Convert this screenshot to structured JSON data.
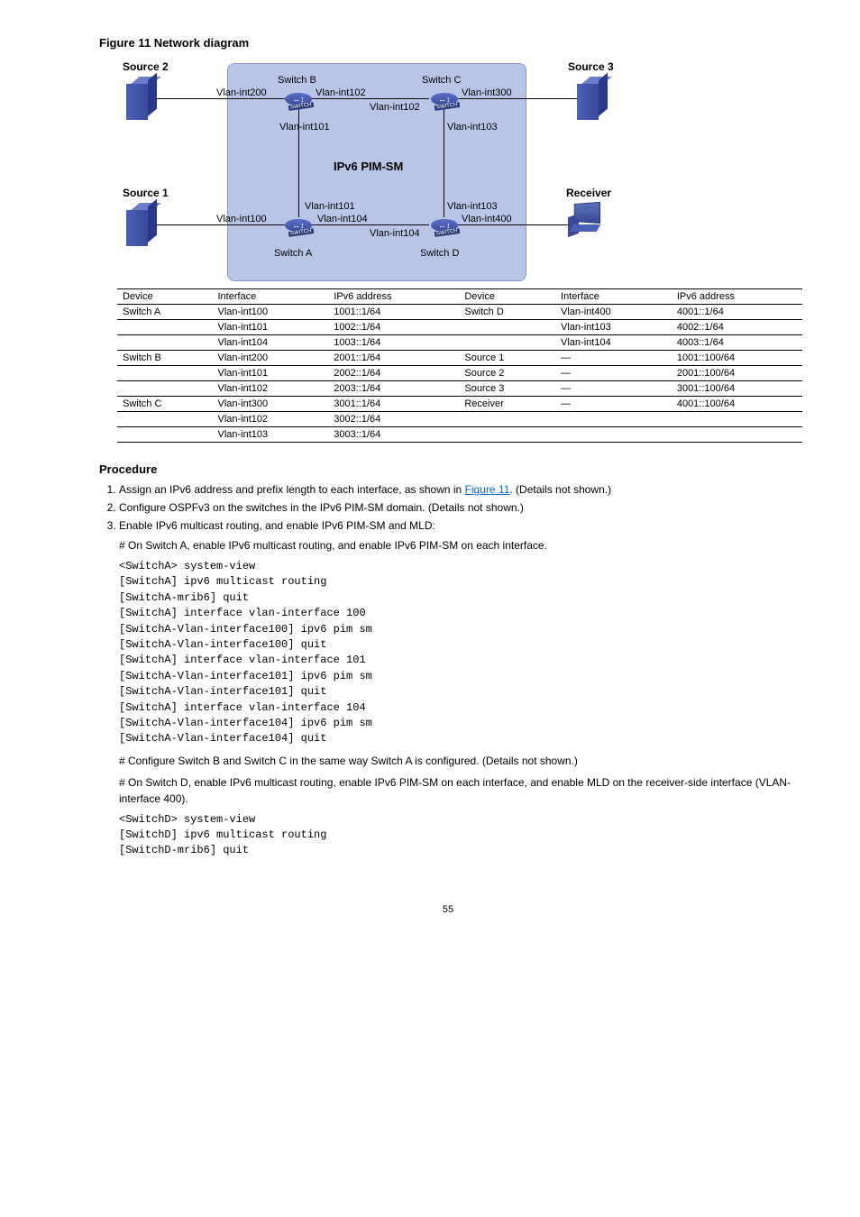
{
  "figure_title": "Figure 11 Network diagram",
  "diagram": {
    "source1": "Source 1",
    "source2": "Source 2",
    "source3": "Source 3",
    "receiver": "Receiver",
    "switchA": "Switch A",
    "switchB": "Switch B",
    "switchC": "Switch C",
    "switchD": "Switch D",
    "pim": "IPv6 PIM-SM",
    "vlan100": "Vlan-int100",
    "vlan200": "Vlan-int200",
    "vlan300": "Vlan-int300",
    "vlan400": "Vlan-int400",
    "vlan101": "Vlan-int101",
    "vlan102": "Vlan-int102",
    "vlan103": "Vlan-int103",
    "vlan104": "Vlan-int104"
  },
  "table": {
    "headers": [
      "Device",
      "Interface",
      "IPv6 address",
      "Device",
      "Interface",
      "IPv6 address"
    ],
    "rows": [
      [
        "Switch A",
        "Vlan-int100",
        "1001::1/64",
        "Switch D",
        "Vlan-int400",
        "4001::1/64"
      ],
      [
        "",
        "Vlan-int101",
        "1002::1/64",
        "",
        "Vlan-int103",
        "4002::1/64"
      ],
      [
        "",
        "Vlan-int104",
        "1003::1/64",
        "",
        "Vlan-int104",
        "4003::1/64"
      ],
      [
        "Switch B",
        "Vlan-int200",
        "2001::1/64",
        "Source 1",
        "—",
        "1001::100/64"
      ],
      [
        "",
        "Vlan-int101",
        "2002::1/64",
        "Source 2",
        "—",
        "2001::100/64"
      ],
      [
        "",
        "Vlan-int102",
        "2003::1/64",
        "Source 3",
        "—",
        "3001::100/64"
      ],
      [
        "Switch C",
        "Vlan-int300",
        "3001::1/64",
        "Receiver",
        "—",
        "4001::100/64"
      ],
      [
        "",
        "Vlan-int102",
        "3002::1/64",
        "",
        "",
        ""
      ],
      [
        "",
        "Vlan-int103",
        "3003::1/64",
        "",
        "",
        ""
      ]
    ]
  },
  "proc_heading": "Procedure",
  "step1": "Assign an IPv6 address and prefix length to each interface, as shown in ",
  "step1_link": "Figure 11",
  "step1_end": ". (Details not shown.)",
  "step2": "Configure OSPFv3 on the switches in the IPv6 PIM-SM domain. (Details not shown.)",
  "step3": "Enable IPv6 multicast routing, and enable IPv6 PIM-SM and MLD:",
  "step3a": "# On Switch A, enable IPv6 multicast routing, and enable IPv6 PIM-SM on each interface.",
  "cli_a": "<SwitchA> system-view\n[SwitchA] ipv6 multicast routing\n[SwitchA-mrib6] quit\n[SwitchA] interface vlan-interface 100\n[SwitchA-Vlan-interface100] ipv6 pim sm\n[SwitchA-Vlan-interface100] quit\n[SwitchA] interface vlan-interface 101\n[SwitchA-Vlan-interface101] ipv6 pim sm\n[SwitchA-Vlan-interface101] quit\n[SwitchA] interface vlan-interface 104\n[SwitchA-Vlan-interface104] ipv6 pim sm\n[SwitchA-Vlan-interface104] quit",
  "step3b": "# Configure Switch B and Switch C in the same way Switch A is configured. (Details not shown.)",
  "step3c": "# On Switch D, enable IPv6 multicast routing, enable IPv6 PIM-SM on each interface, and enable MLD on the receiver-side interface (VLAN-interface 400).",
  "cli_d": "<SwitchD> system-view\n[SwitchD] ipv6 multicast routing\n[SwitchD-mrib6] quit",
  "page_num": "55"
}
